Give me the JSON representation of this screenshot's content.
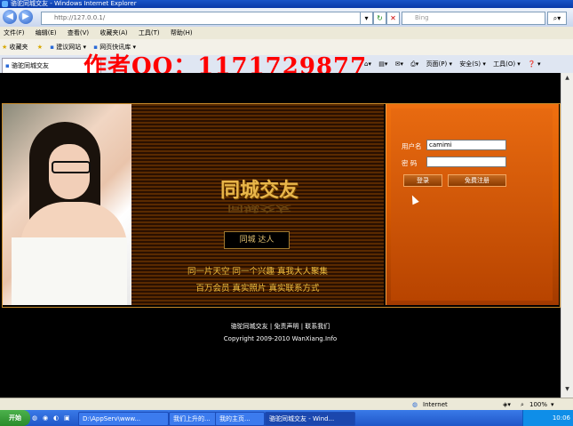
{
  "window": {
    "title": "骆驼同城交友 - Windows Internet Explorer"
  },
  "address_bar": {
    "url": "http://127.0.0.1/",
    "search_placeholder": "Bing"
  },
  "menu": {
    "items": [
      "文件(F)",
      "编辑(E)",
      "查看(V)",
      "收藏夹(A)",
      "工具(T)",
      "帮助(H)"
    ]
  },
  "favorites": {
    "label": "收藏夹",
    "links": [
      "建议网站 ▾",
      "网页快讯库 ▾"
    ]
  },
  "tab": {
    "title": "骆驼同城交友",
    "tools": [
      "页面(P) ▾",
      "安全(S) ▾",
      "工具(O) ▾",
      "❓ ▾"
    ]
  },
  "watermark": {
    "text": "作者QQ：1171729877"
  },
  "banner": {
    "logo": "同城交友",
    "seal": "同城 达人",
    "slogan1": "同一片天空 同一个兴趣 真我大人聚集",
    "slogan2": "百万会员  真实照片  真实联系方式"
  },
  "login": {
    "username_label": "用户名",
    "username_value": "camimi",
    "password_label": "密  码",
    "password_value": "",
    "login_button": "登录",
    "register_button": "免费注册"
  },
  "footer": {
    "links": "骆驼同城交友 | 免责声明 | 联系我们",
    "copyright": "Copyright 2009-2010 WanXiang.Info"
  },
  "statusbar": {
    "zone": "Internet",
    "zoom": "100%"
  },
  "taskbar": {
    "start": "开始",
    "tasks": [
      "D:\\AppServ\\www...",
      "我们上升的...",
      "我的主页...",
      "骆驼同城交友 - Wind..."
    ],
    "clock": "10:06"
  }
}
